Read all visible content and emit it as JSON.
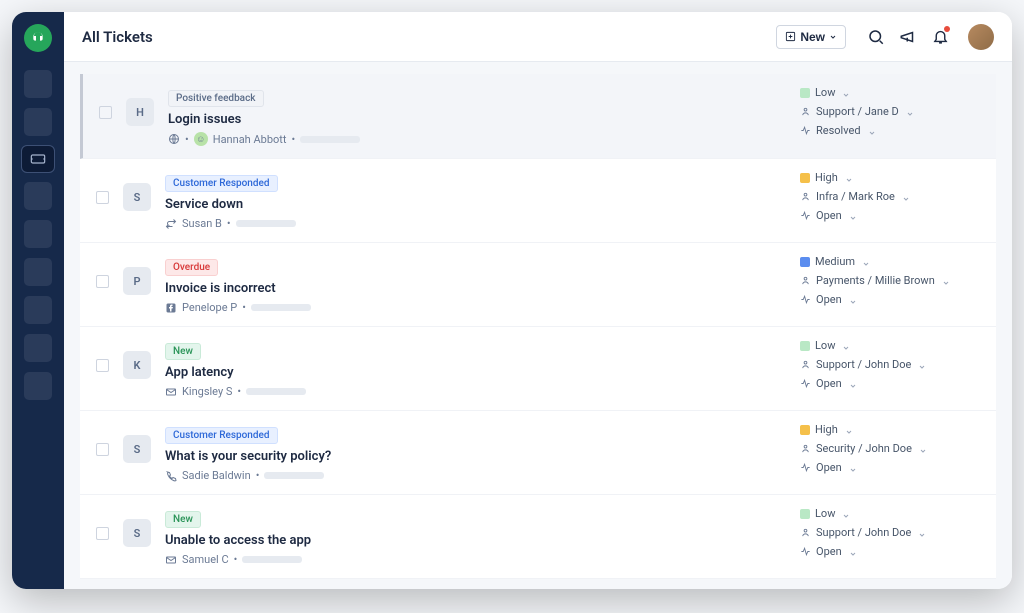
{
  "header": {
    "title": "All Tickets",
    "new_button": "New"
  },
  "tickets": [
    {
      "initial": "H",
      "tag": {
        "text": "Positive feedback",
        "kind": "neutral"
      },
      "title": "Login issues",
      "requester": "Hannah Abbott",
      "channel_icon": "globe",
      "show_face": true,
      "priority": {
        "label": "Low",
        "kind": "low"
      },
      "assignee": "Support / Jane D",
      "status": "Resolved",
      "selected": true
    },
    {
      "initial": "S",
      "tag": {
        "text": "Customer Responded",
        "kind": "blue"
      },
      "title": "Service down",
      "requester": "Susan B",
      "channel_icon": "rt",
      "show_face": false,
      "priority": {
        "label": "High",
        "kind": "high"
      },
      "assignee": "Infra / Mark Roe",
      "status": "Open",
      "selected": false
    },
    {
      "initial": "P",
      "tag": {
        "text": "Overdue",
        "kind": "red"
      },
      "title": "Invoice is incorrect",
      "requester": "Penelope P",
      "channel_icon": "fb",
      "show_face": false,
      "priority": {
        "label": "Medium",
        "kind": "medium"
      },
      "assignee": "Payments / Millie Brown",
      "status": "Open",
      "selected": false
    },
    {
      "initial": "K",
      "tag": {
        "text": "New",
        "kind": "green"
      },
      "title": "App latency",
      "requester": "Kingsley S",
      "channel_icon": "mail",
      "show_face": false,
      "priority": {
        "label": "Low",
        "kind": "low"
      },
      "assignee": "Support / John Doe",
      "status": "Open",
      "selected": false
    },
    {
      "initial": "S",
      "tag": {
        "text": "Customer Responded",
        "kind": "blue"
      },
      "title": "What is your security policy?",
      "requester": "Sadie Baldwin",
      "channel_icon": "phone",
      "show_face": false,
      "priority": {
        "label": "High",
        "kind": "high"
      },
      "assignee": "Security / John Doe",
      "status": "Open",
      "selected": false
    },
    {
      "initial": "S",
      "tag": {
        "text": "New",
        "kind": "green"
      },
      "title": "Unable to access the app",
      "requester": "Samuel C",
      "channel_icon": "mail",
      "show_face": false,
      "priority": {
        "label": "Low",
        "kind": "low"
      },
      "assignee": "Support / John Doe",
      "status": "Open",
      "selected": false
    }
  ]
}
